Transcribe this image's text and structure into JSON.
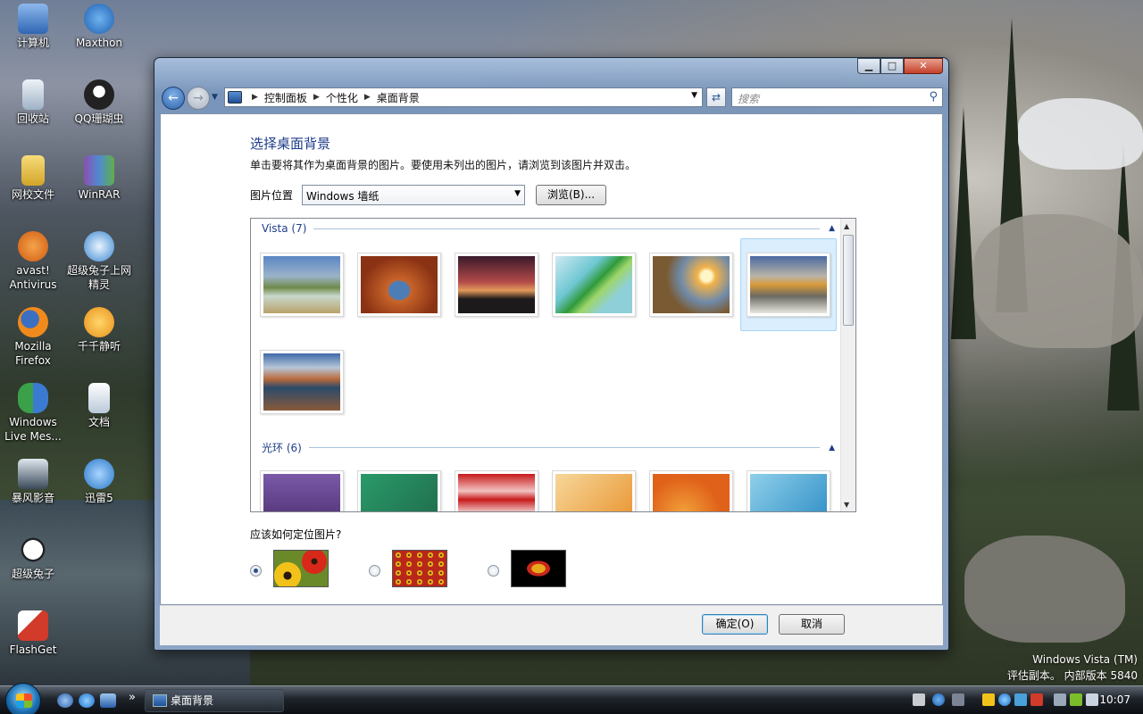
{
  "desktop": {
    "icons": [
      {
        "label": "计算机",
        "color": "#4a7fc8"
      },
      {
        "label": "Maxthon",
        "color": "#2f7ad0"
      },
      {
        "label": "回收站",
        "color": "#b8c8d8"
      },
      {
        "label": "QQ珊瑚虫",
        "color": "#222222"
      },
      {
        "label": "网校文件",
        "color": "#e9c24a"
      },
      {
        "label": "WinRAR",
        "color": "#7a4fa0"
      },
      {
        "label": "avast! Antivirus",
        "color": "#e07a1f"
      },
      {
        "label": "超级兔子上网精灵",
        "color": "#3a86d0"
      },
      {
        "label": "Mozilla Firefox",
        "color": "#e8731a"
      },
      {
        "label": "千千静听",
        "color": "#f0a020"
      },
      {
        "label": "Windows Live Mes...",
        "color": "#3aa04a"
      },
      {
        "label": "文档",
        "color": "#c9d7e6"
      },
      {
        "label": "暴风影音",
        "color": "#2a3a4a"
      },
      {
        "label": "迅雷5",
        "color": "#2a78c8"
      },
      {
        "label": "超级兔子",
        "color": "#ffffff"
      },
      {
        "label": "FlashGet",
        "color": "#d23a2a"
      }
    ],
    "watermark_line1": "Windows Vista (TM)",
    "watermark_line2": "评估副本。 内部版本 5840"
  },
  "window": {
    "controls": {
      "minimize": "▁",
      "maximize": "□",
      "close": "✕"
    },
    "breadcrumb": [
      "控制面板",
      "个性化",
      "桌面背景"
    ],
    "search_placeholder": "搜索",
    "title": "选择桌面背景",
    "subtitle": "单击要将其作为桌面背景的图片。要使用未列出的图片，请浏览到该图片并双击。",
    "location_label": "图片位置",
    "location_value": "Windows 墙纸",
    "browse_label": "浏览(B)...",
    "groups": [
      {
        "name": "Vista (7)",
        "selected_index": 5
      },
      {
        "name": "光环 (6)"
      }
    ],
    "position_question": "应该如何定位图片?",
    "ok_label": "确定(O)",
    "cancel_label": "取消"
  },
  "taskbar": {
    "active_task": "桌面背景",
    "clock": "10:07",
    "quicklaunch_more": "»"
  }
}
